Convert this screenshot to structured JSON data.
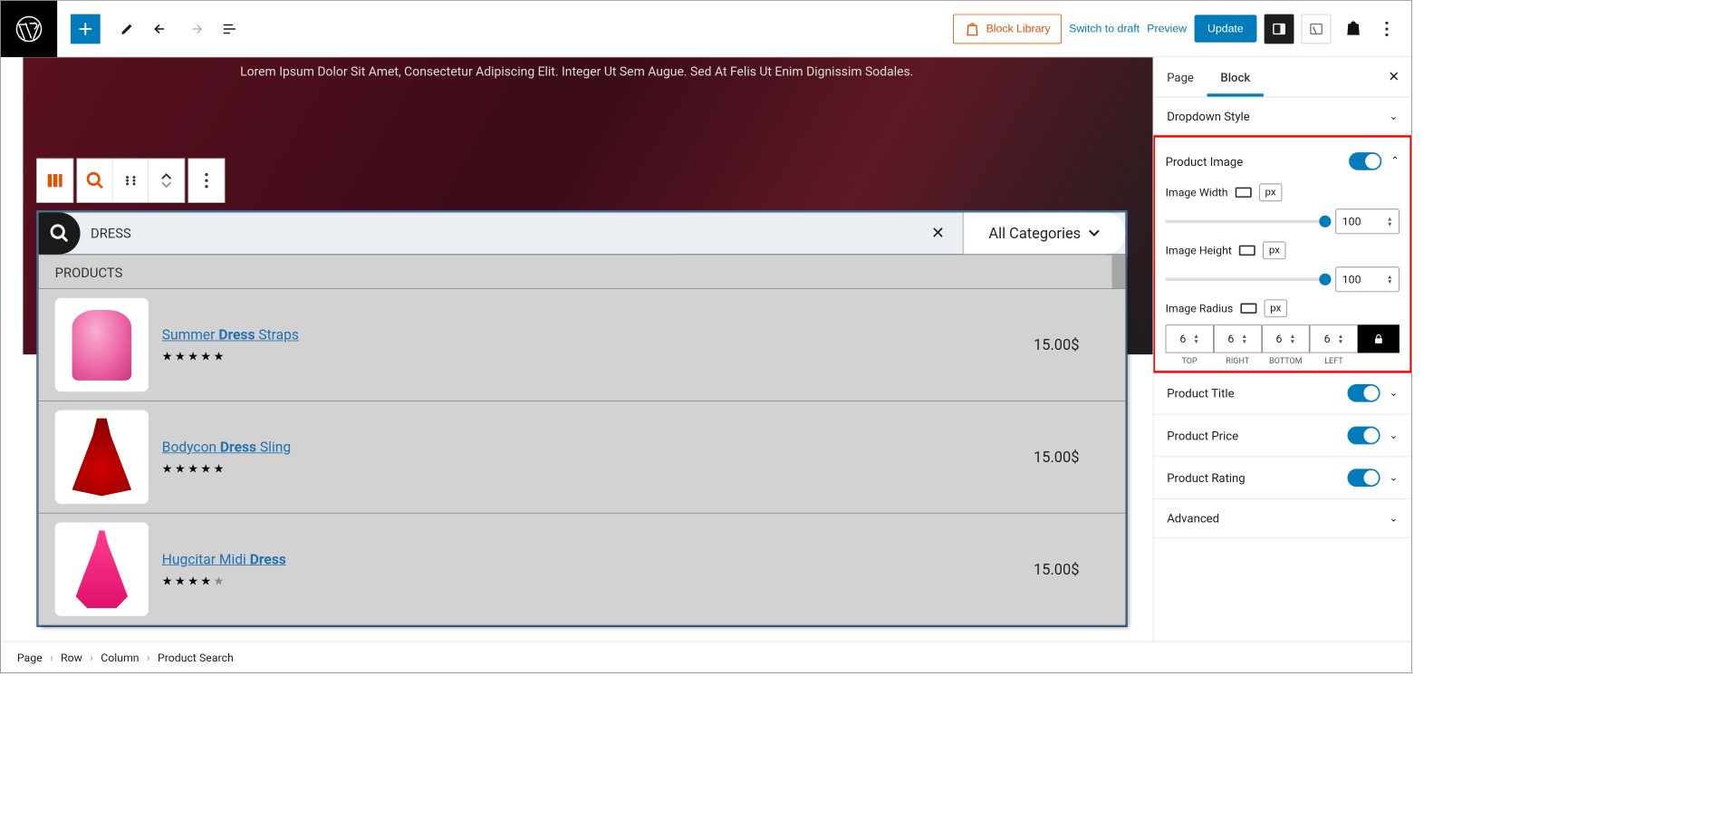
{
  "topbar": {
    "block_library": "Block Library",
    "switch_to_draft": "Switch to draft",
    "preview": "Preview",
    "update": "Update"
  },
  "hero_text": "Lorem Ipsum Dolor Sit Amet, Consectetur Adipiscing Elit. Integer Ut Sem Augue. Sed At Felis Ut Enim Dignissim Sodales.",
  "search": {
    "value": "DRESS",
    "category": "All Categories"
  },
  "results": {
    "header": "PRODUCTS",
    "items": [
      {
        "title_pre": "Summer ",
        "title_hl": "Dress",
        "title_post": " Straps",
        "rating": 5,
        "price": "15.00$"
      },
      {
        "title_pre": "Bodycon ",
        "title_hl": "Dress",
        "title_post": " Sling",
        "rating": 5,
        "price": "15.00$"
      },
      {
        "title_pre": "Hugcitar Midi ",
        "title_hl": "Dress",
        "title_post": "",
        "rating": 4,
        "price": "15.00$"
      }
    ]
  },
  "sidebar": {
    "tabs": {
      "page": "Page",
      "block": "Block"
    },
    "dropdown_style": "Dropdown Style",
    "product_image": {
      "title": "Product Image",
      "image_width_label": "Image Width",
      "image_width_value": "100",
      "image_height_label": "Image Height",
      "image_height_value": "100",
      "image_radius_label": "Image Radius",
      "radius": {
        "top": "6",
        "right": "6",
        "bottom": "6",
        "left": "6"
      },
      "radius_labels": {
        "top": "TOP",
        "right": "RIGHT",
        "bottom": "BOTTOM",
        "left": "LEFT"
      },
      "unit": "px"
    },
    "product_title": "Product Title",
    "product_price": "Product Price",
    "product_rating": "Product Rating",
    "advanced": "Advanced"
  },
  "breadcrumb": [
    "Page",
    "Row",
    "Column",
    "Product Search"
  ]
}
